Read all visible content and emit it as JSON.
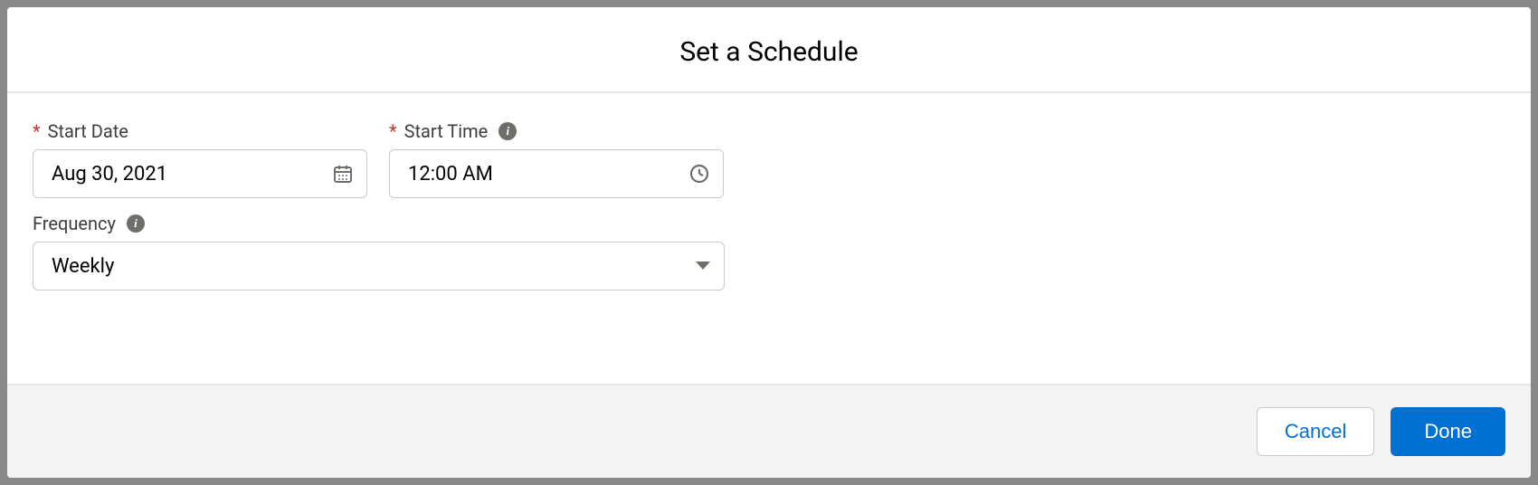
{
  "dialog": {
    "title": "Set a Schedule"
  },
  "fields": {
    "start_date": {
      "label": "Start Date",
      "value": "Aug 30, 2021",
      "required": true
    },
    "start_time": {
      "label": "Start Time",
      "value": "12:00 AM",
      "required": true
    },
    "frequency": {
      "label": "Frequency",
      "value": "Weekly"
    }
  },
  "footer": {
    "cancel_label": "Cancel",
    "done_label": "Done"
  }
}
